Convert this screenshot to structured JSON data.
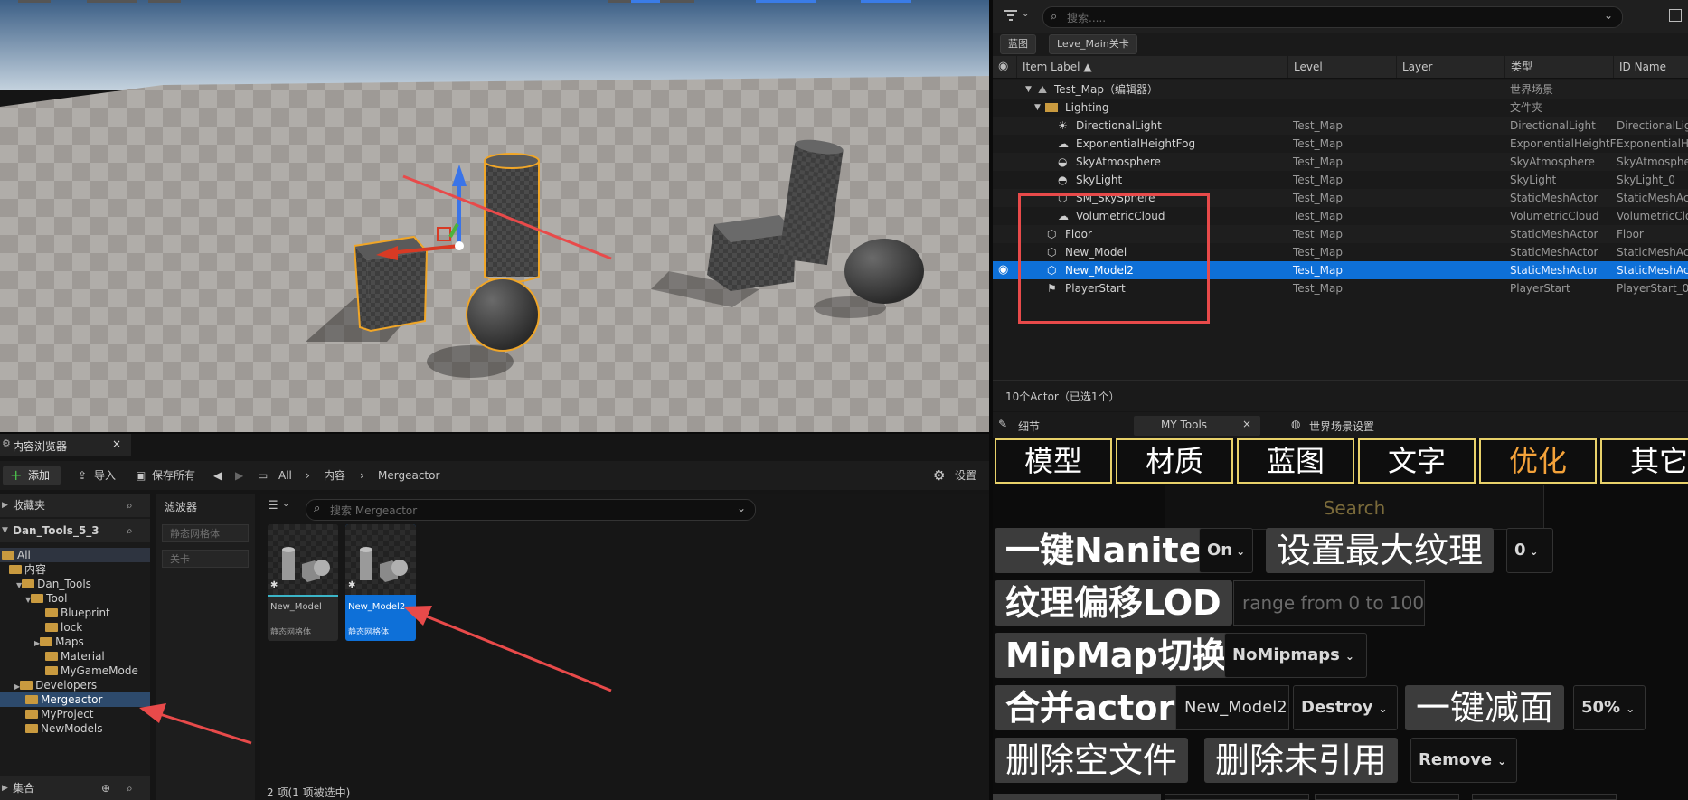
{
  "outliner": {
    "search_placeholder": "搜索.....",
    "chip_blueprint": "蓝图",
    "chip_level": "Leve_Main关卡",
    "columns": {
      "item_label": "Item Label ▲",
      "level": "Level",
      "layer": "Layer",
      "type": "类型",
      "id_name": "ID Name"
    },
    "rows": [
      {
        "label": "Test_Map（编辑器）",
        "level": "",
        "type": "世界场景",
        "id": ""
      },
      {
        "label": "Lighting",
        "level": "",
        "type": "文件夹",
        "id": ""
      },
      {
        "label": "DirectionalLight",
        "level": "Test_Map",
        "type": "DirectionalLight",
        "id": "DirectionalLight"
      },
      {
        "label": "ExponentialHeightFog",
        "level": "Test_Map",
        "type": "ExponentialHeightF",
        "id": "ExponentialHeight"
      },
      {
        "label": "SkyAtmosphere",
        "level": "Test_Map",
        "type": "SkyAtmosphere",
        "id": "SkyAtmosphere"
      },
      {
        "label": "SkyLight",
        "level": "Test_Map",
        "type": "SkyLight",
        "id": "SkyLight_0"
      },
      {
        "label": "SM_SkySphere",
        "level": "Test_Map",
        "type": "StaticMeshActor",
        "id": "StaticMeshAc"
      },
      {
        "label": "VolumetricCloud",
        "level": "Test_Map",
        "type": "VolumetricCloud",
        "id": "VolumetricClo"
      },
      {
        "label": "Floor",
        "level": "Test_Map",
        "type": "StaticMeshActor",
        "id": "Floor"
      },
      {
        "label": "New_Model",
        "level": "Test_Map",
        "type": "StaticMeshActor",
        "id": "StaticMeshAc"
      },
      {
        "label": "New_Model2",
        "level": "Test_Map",
        "type": "StaticMeshActor",
        "id": "StaticMeshAc"
      },
      {
        "label": "PlayerStart",
        "level": "Test_Map",
        "type": "PlayerStart",
        "id": "PlayerStart_0"
      }
    ],
    "status": "10个Actor（已选1个）"
  },
  "content_browser": {
    "tab_title": "内容浏览器",
    "add": "添加",
    "import": "导入",
    "save_all": "保存所有",
    "crumb_all": "All",
    "crumb_content": "内容",
    "crumb_current": "Mergeactor",
    "settings": "设置",
    "favorites": "收藏夹",
    "project": "Dan_Tools_5_3",
    "filters_title": "滤波器",
    "filter1": "静态网格体",
    "filter2": "关卡",
    "search_placeholder": "搜索 Mergeactor",
    "tree": {
      "all": "All",
      "content": "内容",
      "dan_tools": "Dan_Tools",
      "tool": "Tool",
      "blueprint": "Blueprint",
      "lock": "lock",
      "maps": "Maps",
      "material": "Material",
      "mygamemode": "MyGameMode",
      "developers": "Developers",
      "mergeactor": "Mergeactor",
      "myproject": "MyProject",
      "newmodels": "NewModels"
    },
    "assets": [
      {
        "name": "New_Model",
        "type": "静态网格体"
      },
      {
        "name": "New_Model2",
        "type": "静态网格体"
      }
    ],
    "collections": "集合",
    "footer": "2 项(1 项被选中)"
  },
  "tools_panel": {
    "tab_details": "细节",
    "tab_mytools": "MY Tools",
    "tab_world": "世界场景设置",
    "tabs": [
      "模型",
      "材质",
      "蓝图",
      "文字",
      "优化",
      "其它"
    ],
    "search": "Search",
    "nanite_btn": "一键Nanite",
    "nanite_dd": "On",
    "maxtex_btn": "设置最大纹理",
    "maxtex_dd": "0",
    "lod_btn": "纹理偏移LOD",
    "lod_placeholder": "range from 0 to 100",
    "mip_btn": "MipMap切换",
    "mip_dd": "NoMipmaps",
    "merge_btn": "合并actor",
    "merge_input": "New_Model2",
    "merge_dd": "Destroy",
    "reduce_btn": "一键减面",
    "reduce_dd": "50%",
    "del_empty_btn": "删除空文件",
    "del_unref_btn": "删除未引用",
    "del_dd": "Remove"
  },
  "colors": {
    "accent": "#0e70d8",
    "tab_border": "#e8d16a",
    "active_tab": "#f4a23a",
    "annotation": "#e84a4a"
  }
}
